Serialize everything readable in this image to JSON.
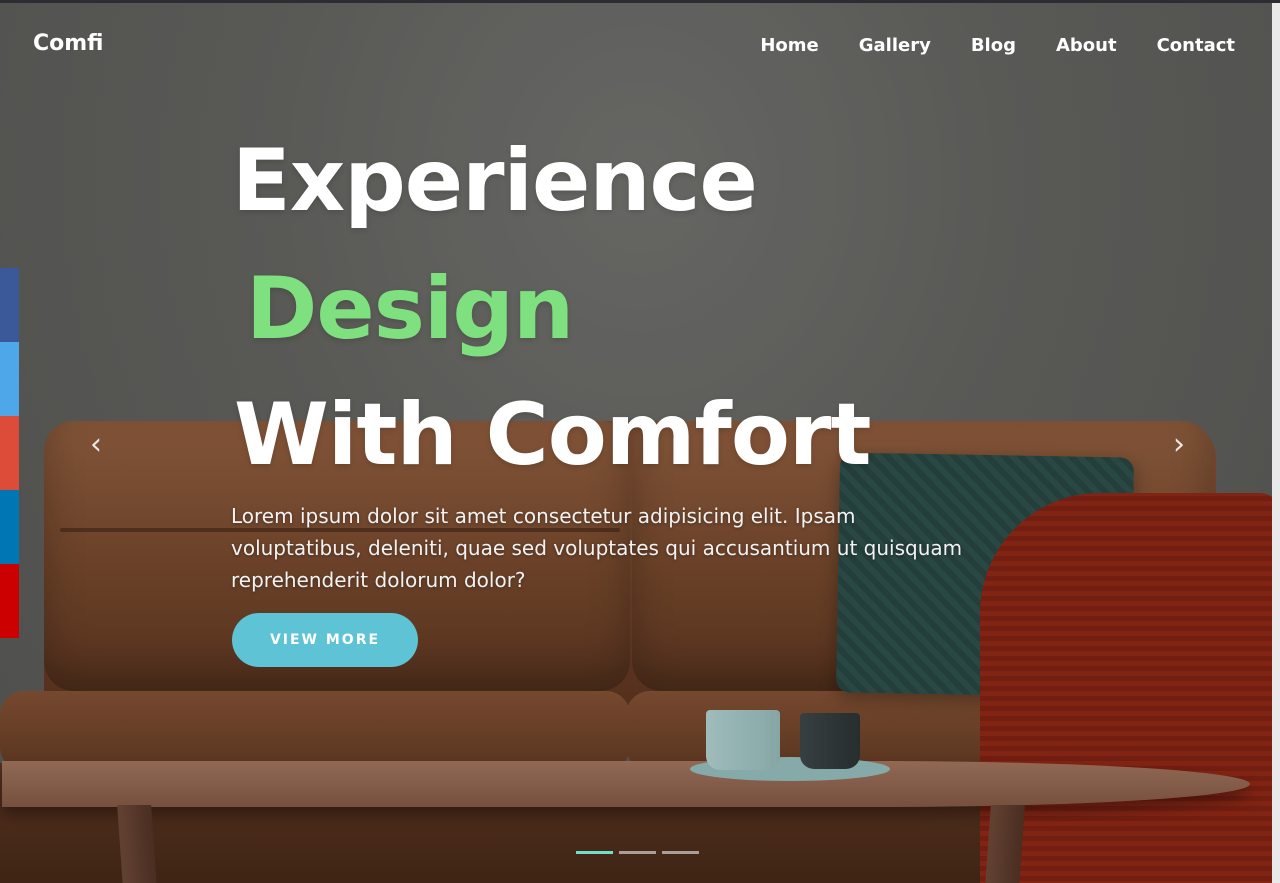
{
  "brand": {
    "logo_text": "Comfi"
  },
  "nav": {
    "items": [
      {
        "label": "Home"
      },
      {
        "label": "Gallery"
      },
      {
        "label": "Blog"
      },
      {
        "label": "About"
      },
      {
        "label": "Contact"
      }
    ]
  },
  "hero": {
    "line1": "Experience",
    "line2": "Design",
    "line3": "With Comfort",
    "description": "Lorem ipsum dolor sit amet consectetur adipisicing elit. Ipsam voluptatibus, deleniti, quae sed voluptates qui accusantium ut quisquam reprehenderit dolorum dolor?",
    "button_label": "VIEW MORE",
    "accent_color": "#7ee07f",
    "button_color": "#5fc3d6"
  },
  "carousel": {
    "prev_icon": "‹",
    "next_icon": "›",
    "slide_count": 3,
    "active_index": 0
  },
  "social": {
    "icons": [
      {
        "name": "facebook-icon",
        "color": "#3b5998"
      },
      {
        "name": "twitter-icon",
        "color": "#4da7e8"
      },
      {
        "name": "google-plus-icon",
        "color": "#dd4b39"
      },
      {
        "name": "linkedin-icon",
        "color": "#0077b5"
      },
      {
        "name": "youtube-icon",
        "color": "#cc0000"
      }
    ]
  }
}
